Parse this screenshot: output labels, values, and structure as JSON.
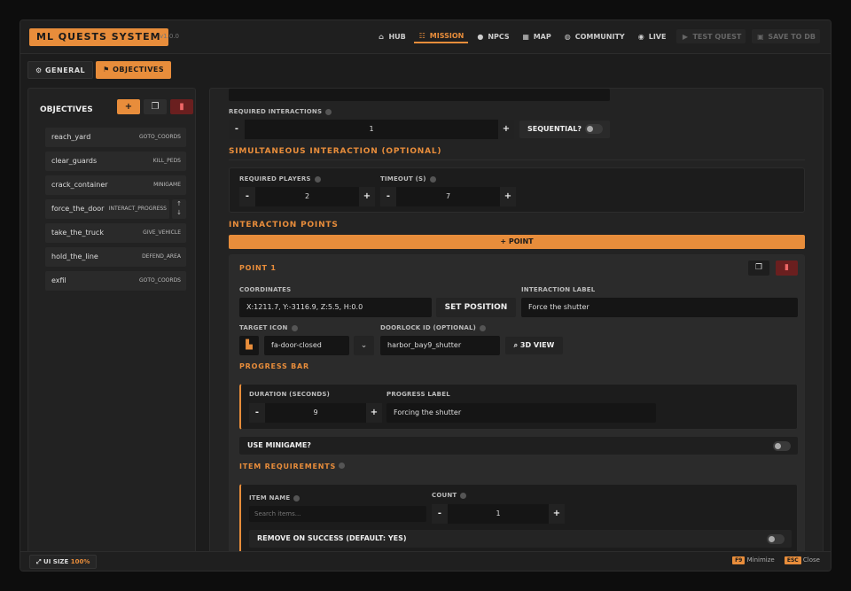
{
  "app": {
    "title": "ML QUESTS SYSTEM",
    "version": "v1.0.0"
  },
  "nav": [
    {
      "label": "HUB",
      "icon": "home-icon",
      "glyph": "⌂"
    },
    {
      "label": "MISSION",
      "icon": "list-icon",
      "glyph": "☷"
    },
    {
      "label": "NPCS",
      "icon": "user-icon",
      "glyph": "●"
    },
    {
      "label": "MAP",
      "icon": "map-icon",
      "glyph": "▦"
    },
    {
      "label": "COMMUNITY",
      "icon": "globe-icon",
      "glyph": "◍"
    },
    {
      "label": "LIVE",
      "icon": "broadcast-icon",
      "glyph": "◉"
    },
    {
      "label": "TEST QUEST",
      "icon": "play-icon",
      "glyph": "▶"
    },
    {
      "label": "SAVE TO DB",
      "icon": "save-icon",
      "glyph": "▣"
    }
  ],
  "tabs": {
    "general": "GENERAL",
    "objectives": "OBJECTIVES"
  },
  "sidebar": {
    "title": "OBJECTIVES",
    "add": "+",
    "items": [
      {
        "name": "reach_yard",
        "type": "GOTO_COORDS"
      },
      {
        "name": "clear_guards",
        "type": "KILL_PEDS"
      },
      {
        "name": "crack_container",
        "type": "MINIGAME"
      },
      {
        "name": "force_the_door",
        "type": "INTERACT_PROGRESS"
      },
      {
        "name": "take_the_truck",
        "type": "GIVE_VEHICLE"
      },
      {
        "name": "hold_the_line",
        "type": "DEFEND_AREA"
      },
      {
        "name": "exfil",
        "type": "GOTO_COORDS"
      }
    ]
  },
  "main": {
    "required_interactions": {
      "label": "REQUIRED INTERACTIONS",
      "value": "1"
    },
    "sequential": "SEQUENTIAL?",
    "simul_title": "SIMULTANEOUS INTERACTION (OPTIONAL)",
    "required_players": {
      "label": "REQUIRED PLAYERS",
      "value": "2"
    },
    "timeout": {
      "label": "TIMEOUT (S)",
      "value": "7"
    },
    "points_title": "INTERACTION POINTS",
    "add_point": "+ POINT",
    "point": {
      "title": "POINT 1",
      "coords_label": "COORDINATES",
      "coords": "X:1211.7, Y:-3116.9, Z:5.5, H:0.0",
      "set_position": "SET POSITION",
      "interaction_label": "INTERACTION LABEL",
      "interaction_value": "Force the shutter",
      "target_icon_label": "TARGET ICON",
      "target_icon_value": "fa-door-closed",
      "doorlock_label": "DOORLOCK ID (OPTIONAL)",
      "doorlock_value": "harbor_bay9_shutter",
      "view3d": "3D VIEW",
      "progress_title": "PROGRESS BAR",
      "duration_label": "DURATION (SECONDS)",
      "duration_value": "9",
      "progress_label": "PROGRESS LABEL",
      "progress_value": "Forcing the shutter",
      "use_minigame": "USE MINIGAME?",
      "items_title": "ITEM REQUIREMENTS",
      "item_name_label": "ITEM NAME",
      "item_placeholder": "Search items...",
      "count_label": "COUNT",
      "count_value": "1",
      "remove_label": "REMOVE ON SUCCESS (DEFAULT: YES)"
    }
  },
  "footer": {
    "ui_size": "UI SIZE",
    "ui_value": "100%",
    "f9": "F9",
    "minimize": "Minimize",
    "esc": "ESC",
    "close": "Close"
  }
}
